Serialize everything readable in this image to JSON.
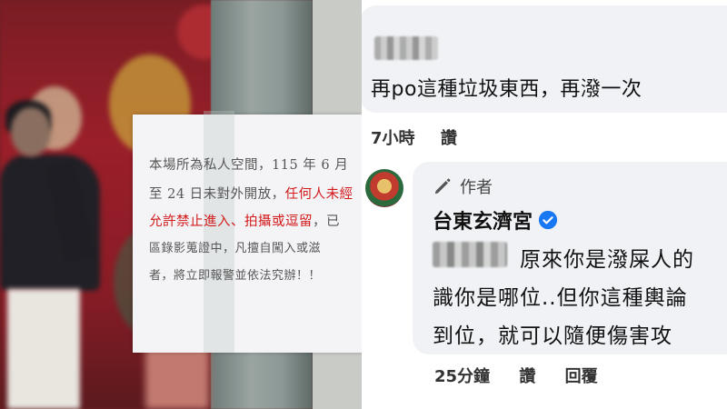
{
  "photo": {
    "notice_lines": [
      "本場所為私人空間，115 年 6 月",
      "至 24 日未對外開放，",
      "任何人未經",
      "允許禁止進入、",
      "拍攝或逗留",
      "，已",
      "區錄影蒐證中，凡擅自闖入或滋",
      "者，將立即報警並依法究辦！！"
    ]
  },
  "comment1": {
    "text": "再po這種垃圾東西，再潑一次",
    "time": "7小時",
    "like_label": "讚"
  },
  "reply": {
    "author_badge": "作者",
    "name": "台東玄濟宮",
    "lines": [
      "原來你是潑屎人的",
      "識你是哪位..但你這種輿論",
      "到位，就可以隨便傷害攻"
    ],
    "time": "25分鐘",
    "like_label": "讚",
    "reply_label": "回覆"
  },
  "colors": {
    "bubble_bg": "#f0f2f5",
    "verified_blue": "#1877f2",
    "notice_red": "#d21a1a"
  },
  "icons": {
    "author_icon": "pen-icon",
    "verified_icon": "verified-badge-icon"
  }
}
